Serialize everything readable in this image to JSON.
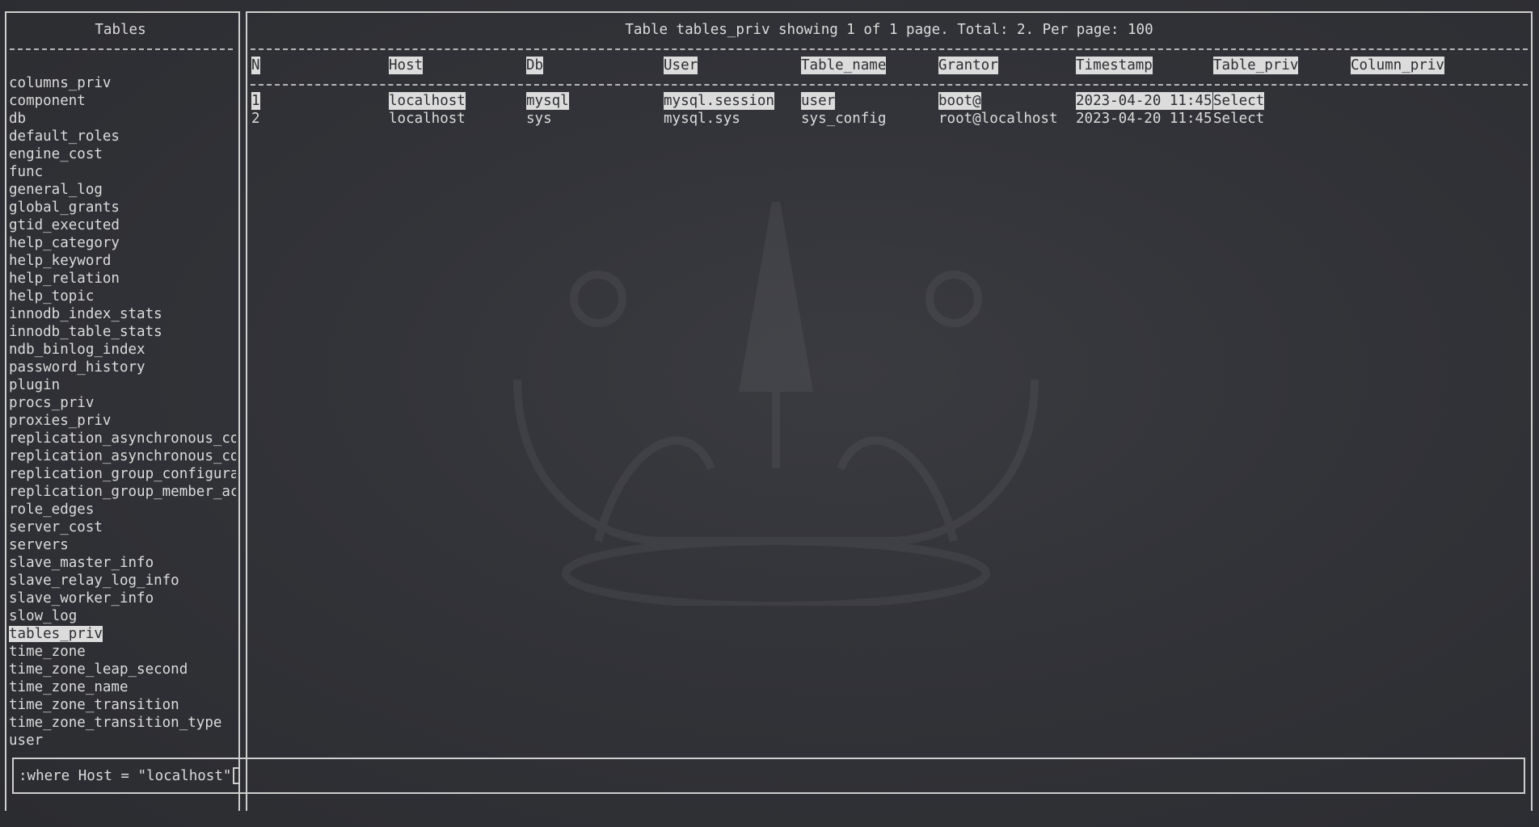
{
  "sidebar": {
    "title": "Tables",
    "items": [
      "columns_priv",
      "component",
      "db",
      "default_roles",
      "engine_cost",
      "func",
      "general_log",
      "global_grants",
      "gtid_executed",
      "help_category",
      "help_keyword",
      "help_relation",
      "help_topic",
      "innodb_index_stats",
      "innodb_table_stats",
      "ndb_binlog_index",
      "password_history",
      "plugin",
      "procs_priv",
      "proxies_priv",
      "replication_asynchronous_con",
      "replication_asynchronous_con",
      "replication_group_configurat",
      "replication_group_member_act",
      "role_edges",
      "server_cost",
      "servers",
      "slave_master_info",
      "slave_relay_log_info",
      "slave_worker_info",
      "slow_log",
      "tables_priv",
      "time_zone",
      "time_zone_leap_second",
      "time_zone_name",
      "time_zone_transition",
      "time_zone_transition_type",
      "user"
    ],
    "selected": "tables_priv"
  },
  "main": {
    "header": "Table tables_priv showing 1 of 1 page. Total: 2. Per page: 100",
    "columns": [
      "N",
      "Host",
      "Db",
      "User",
      "Table_name",
      "Grantor",
      "Timestamp",
      "Table_priv",
      "Column_priv"
    ],
    "rows": [
      [
        "1",
        "localhost",
        "mysql",
        "mysql.session",
        "user",
        "boot@",
        "2023-04-20 11:45",
        "Select",
        ""
      ],
      [
        "2",
        "localhost",
        "sys",
        "mysql.sys",
        "sys_config",
        "root@localhost",
        "2023-04-20 11:45",
        "Select",
        ""
      ]
    ],
    "selected_row": 0
  },
  "command": {
    "text": ":where Host = \"localhost\""
  },
  "colors": {
    "background": "#323338",
    "foreground": "#dcdcdc",
    "highlight_bg": "#dcdcdc",
    "highlight_fg": "#2d2e32"
  }
}
